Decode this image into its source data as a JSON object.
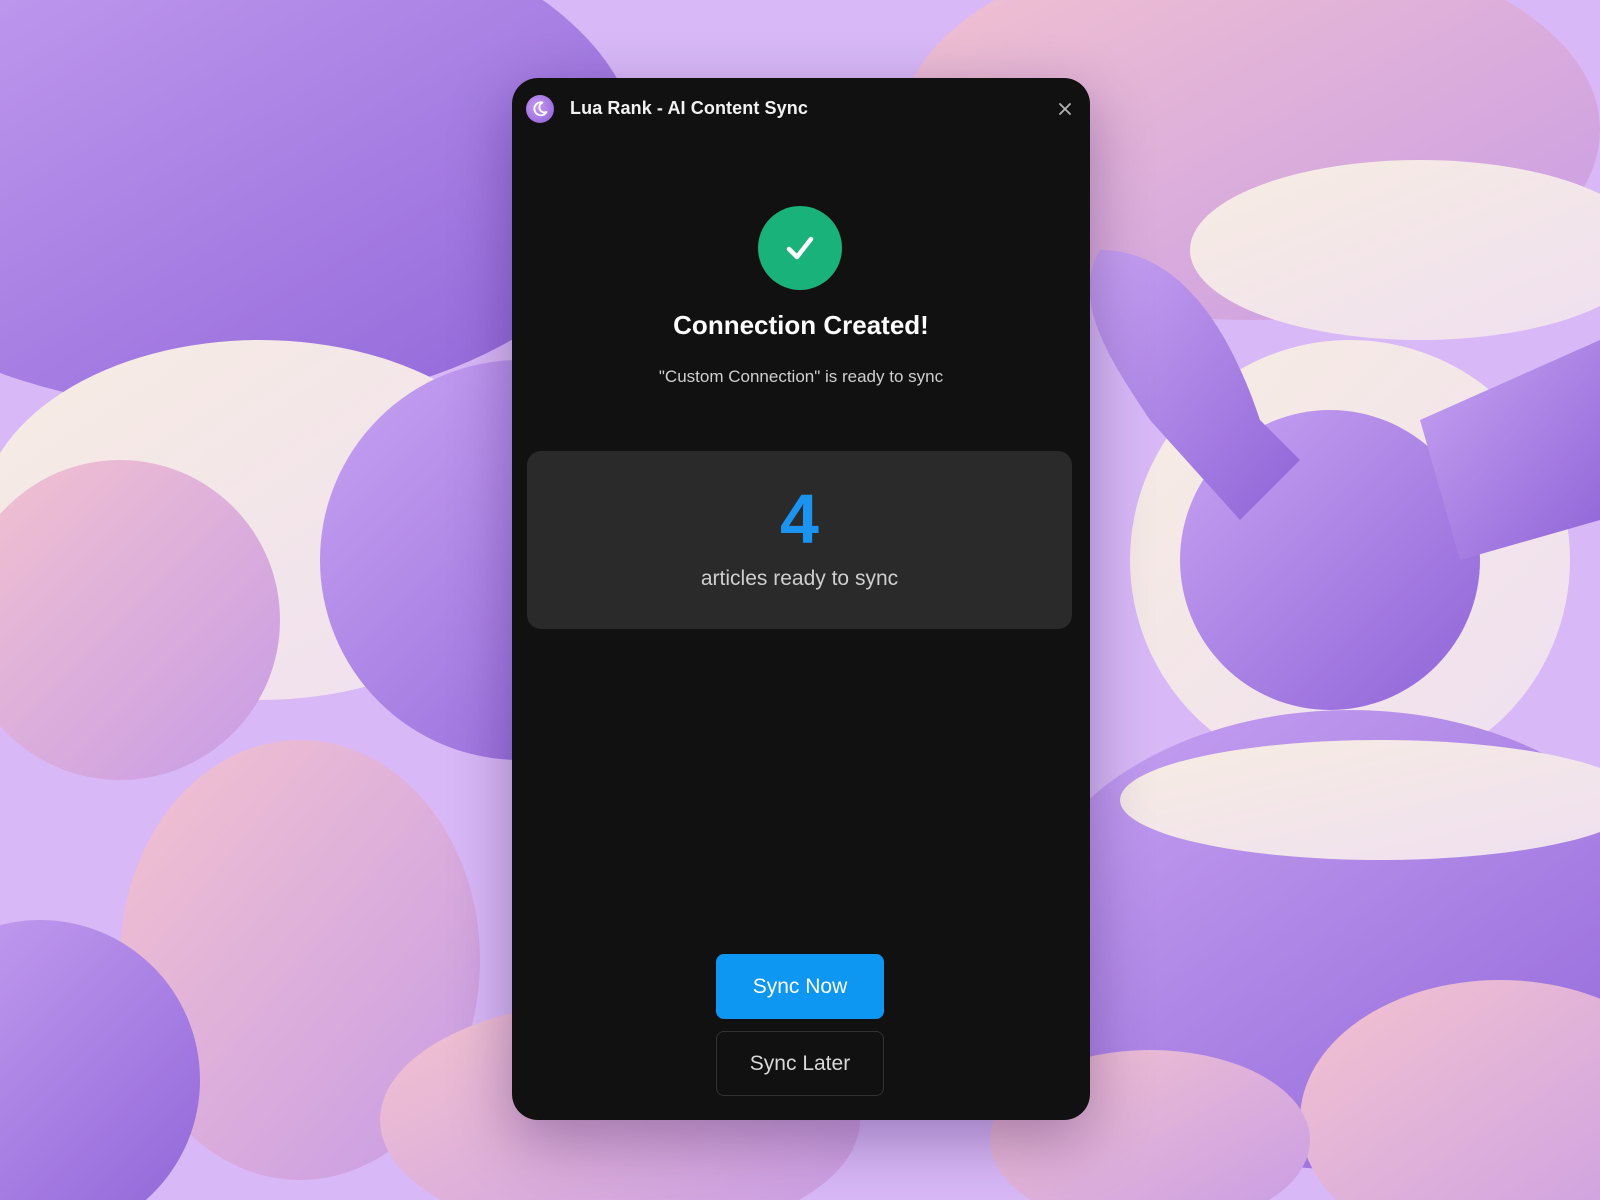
{
  "window": {
    "title": "Lua Rank - AI Content Sync",
    "logo_icon": "crescent-moon-icon",
    "close_icon": "close-icon"
  },
  "success": {
    "icon": "checkmark-icon",
    "heading": "Connection Created!",
    "subtext": "\"Custom Connection\" is ready to sync"
  },
  "stats": {
    "count": "4",
    "label": "articles ready to sync"
  },
  "actions": {
    "primary_label": "Sync Now",
    "secondary_label": "Sync Later"
  },
  "colors": {
    "background": "#d6b4f5",
    "window": "#111111",
    "card": "#2a2a2a",
    "success": "#19b27b",
    "accent": "#0d96f2",
    "count": "#1a94f0"
  }
}
